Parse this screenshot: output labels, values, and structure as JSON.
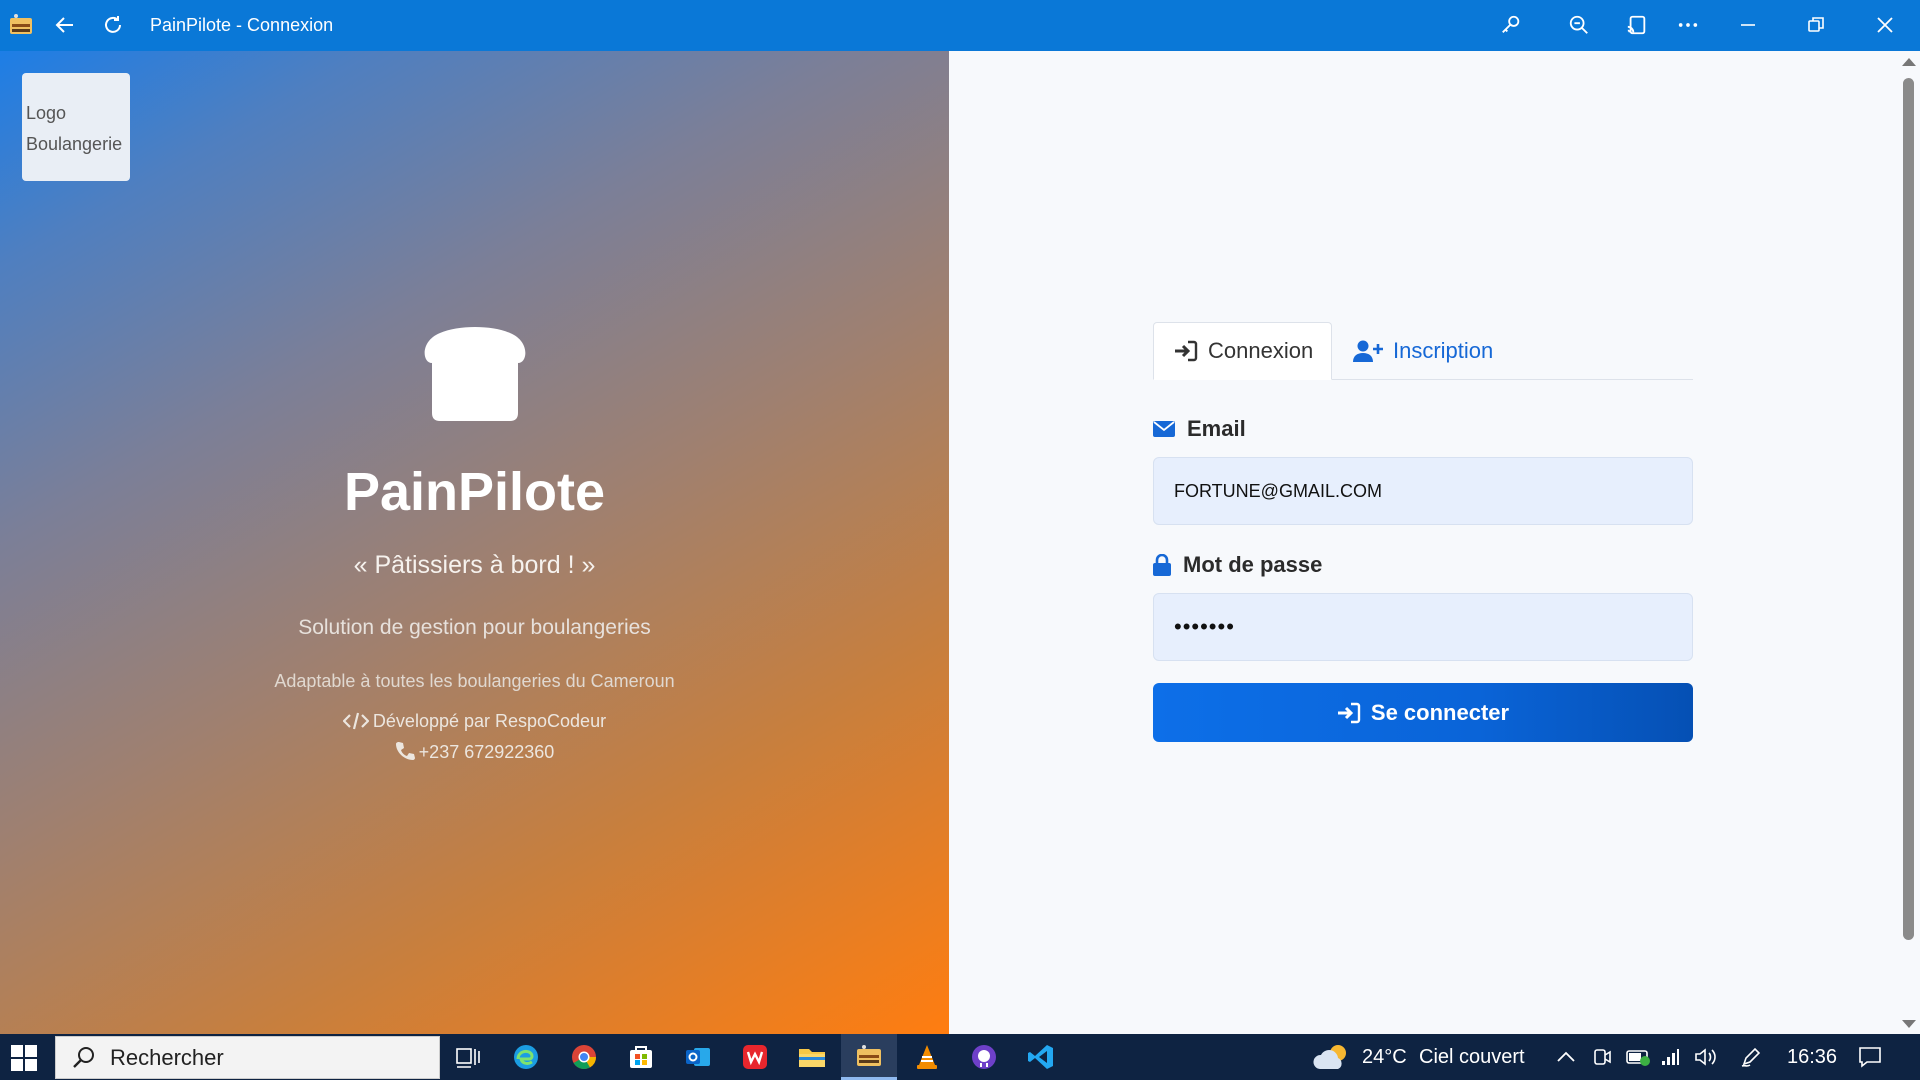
{
  "window": {
    "title": "PainPilote - Connexion",
    "icons": [
      "app-icon",
      "back-arrow-icon",
      "refresh-icon",
      "key-icon",
      "zoom-out-icon",
      "cast-icon",
      "more-icon",
      "minimize-icon",
      "restore-icon",
      "close-icon"
    ]
  },
  "left_panel": {
    "logo_line1": "Logo",
    "logo_line2": "Boulangerie",
    "title": "PainPilote",
    "slogan": "« Pâtissiers à bord ! »",
    "subtitle": "Solution de gestion pour boulangeries",
    "adaptable": "Adaptable à toutes les boulangeries du Cameroun",
    "developer": "Développé par RespoCodeur",
    "phone": "+237 672922360",
    "gradient": [
      "#1d7ee6",
      "#ff7d10"
    ]
  },
  "login": {
    "tabs": [
      {
        "label": "Connexion",
        "active": true
      },
      {
        "label": "Inscription",
        "active": false
      }
    ],
    "email_label": "Email",
    "email_value": "FORTUNE@GMAIL.COM",
    "password_label": "Mot de passe",
    "password_value": "•••••••",
    "submit_label": "Se connecter",
    "accent_color": "#0d6fe8"
  },
  "taskbar": {
    "search_placeholder": "Rechercher",
    "weather_temp": "24°C",
    "weather_text": "Ciel couvert",
    "time": "16:36",
    "apps": [
      "task-view",
      "edge",
      "chrome",
      "store",
      "outlook",
      "wps-office",
      "file-explorer",
      "painpilote",
      "vlc",
      "github-desktop",
      "vscode"
    ]
  }
}
